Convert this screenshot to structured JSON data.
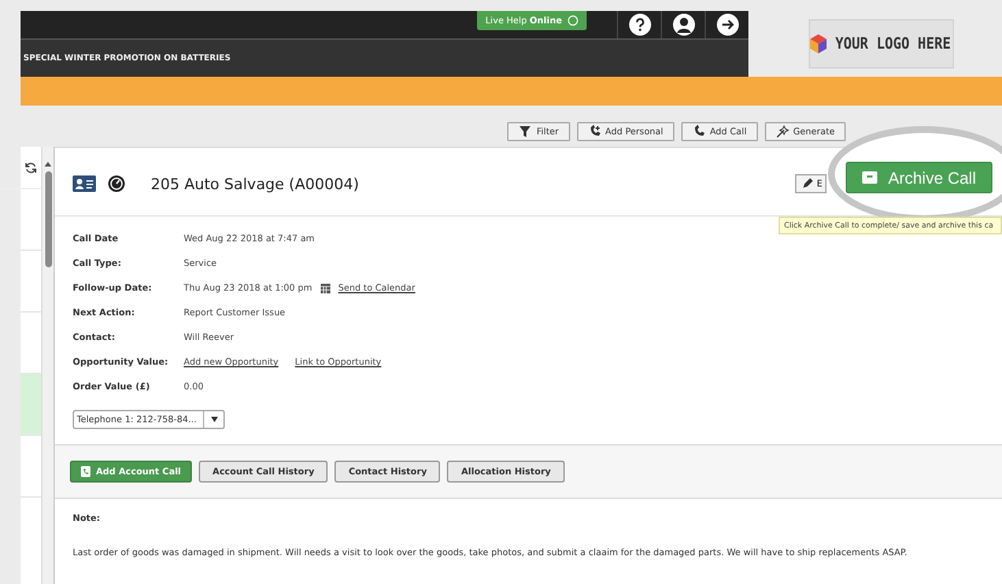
{
  "header": {
    "live_help": {
      "label": "Live Help",
      "status": "Online"
    },
    "promo": "SPECIAL WINTER PROMOTION ON BATTERIES",
    "logo": "YOUR LOGO HERE"
  },
  "toolbar": [
    {
      "kind": "filter",
      "label": "Filter"
    },
    {
      "kind": "add_phone",
      "label": "Add Personal"
    },
    {
      "kind": "phone",
      "label": "Add Call"
    },
    {
      "kind": "wand",
      "label": "Generate"
    }
  ],
  "sidebar_rows": [
    {
      "selected": false
    },
    {
      "selected": false
    },
    {
      "selected": false
    },
    {
      "selected": true
    },
    {
      "selected": false
    }
  ],
  "record": {
    "title": "205 Auto Salvage (A00004)",
    "edit_label": "E",
    "fields": [
      {
        "label": "Call Date",
        "parts": [
          {
            "kind": "text",
            "text": "Wed Aug 22 2018 at 7:47 am"
          }
        ]
      },
      {
        "label": "Call Type:",
        "parts": [
          {
            "kind": "text",
            "text": "Service"
          }
        ]
      },
      {
        "label": "Follow-up Date:",
        "parts": [
          {
            "kind": "text",
            "text": "Thu Aug 23 2018 at 1:00 pm"
          },
          {
            "kind": "calendar_link",
            "text": "Send to Calendar"
          }
        ]
      },
      {
        "label": "Next Action:",
        "parts": [
          {
            "kind": "text",
            "text": "Report Customer Issue"
          }
        ]
      },
      {
        "label": "Contact:",
        "parts": [
          {
            "kind": "text",
            "text": "Will Reever"
          }
        ]
      },
      {
        "label": "Opportunity Value:",
        "parts": [
          {
            "kind": "link",
            "text": "Add new Opportunity"
          },
          {
            "kind": "link",
            "text": "Link to Opportunity"
          }
        ]
      },
      {
        "label": "Order Value (£)",
        "parts": [
          {
            "kind": "text",
            "text": "0.00"
          }
        ]
      }
    ],
    "phone": "Telephone 1: 212-758-84..."
  },
  "actions": [
    {
      "label": "Add Account Call",
      "primary": true
    },
    {
      "label": "Account Call History",
      "primary": false
    },
    {
      "label": "Contact History",
      "primary": false
    },
    {
      "label": "Allocation History",
      "primary": false
    }
  ],
  "note": {
    "label": "Note:",
    "text": "Last order of goods was damaged in shipment. Will needs a visit to look over the goods, take photos, and submit a claaim for the damaged parts. We will have to ship replacements ASAP."
  },
  "archive": {
    "label": "Archive Call",
    "tooltip": "Click Archive Call to complete/ save and archive this ca"
  }
}
